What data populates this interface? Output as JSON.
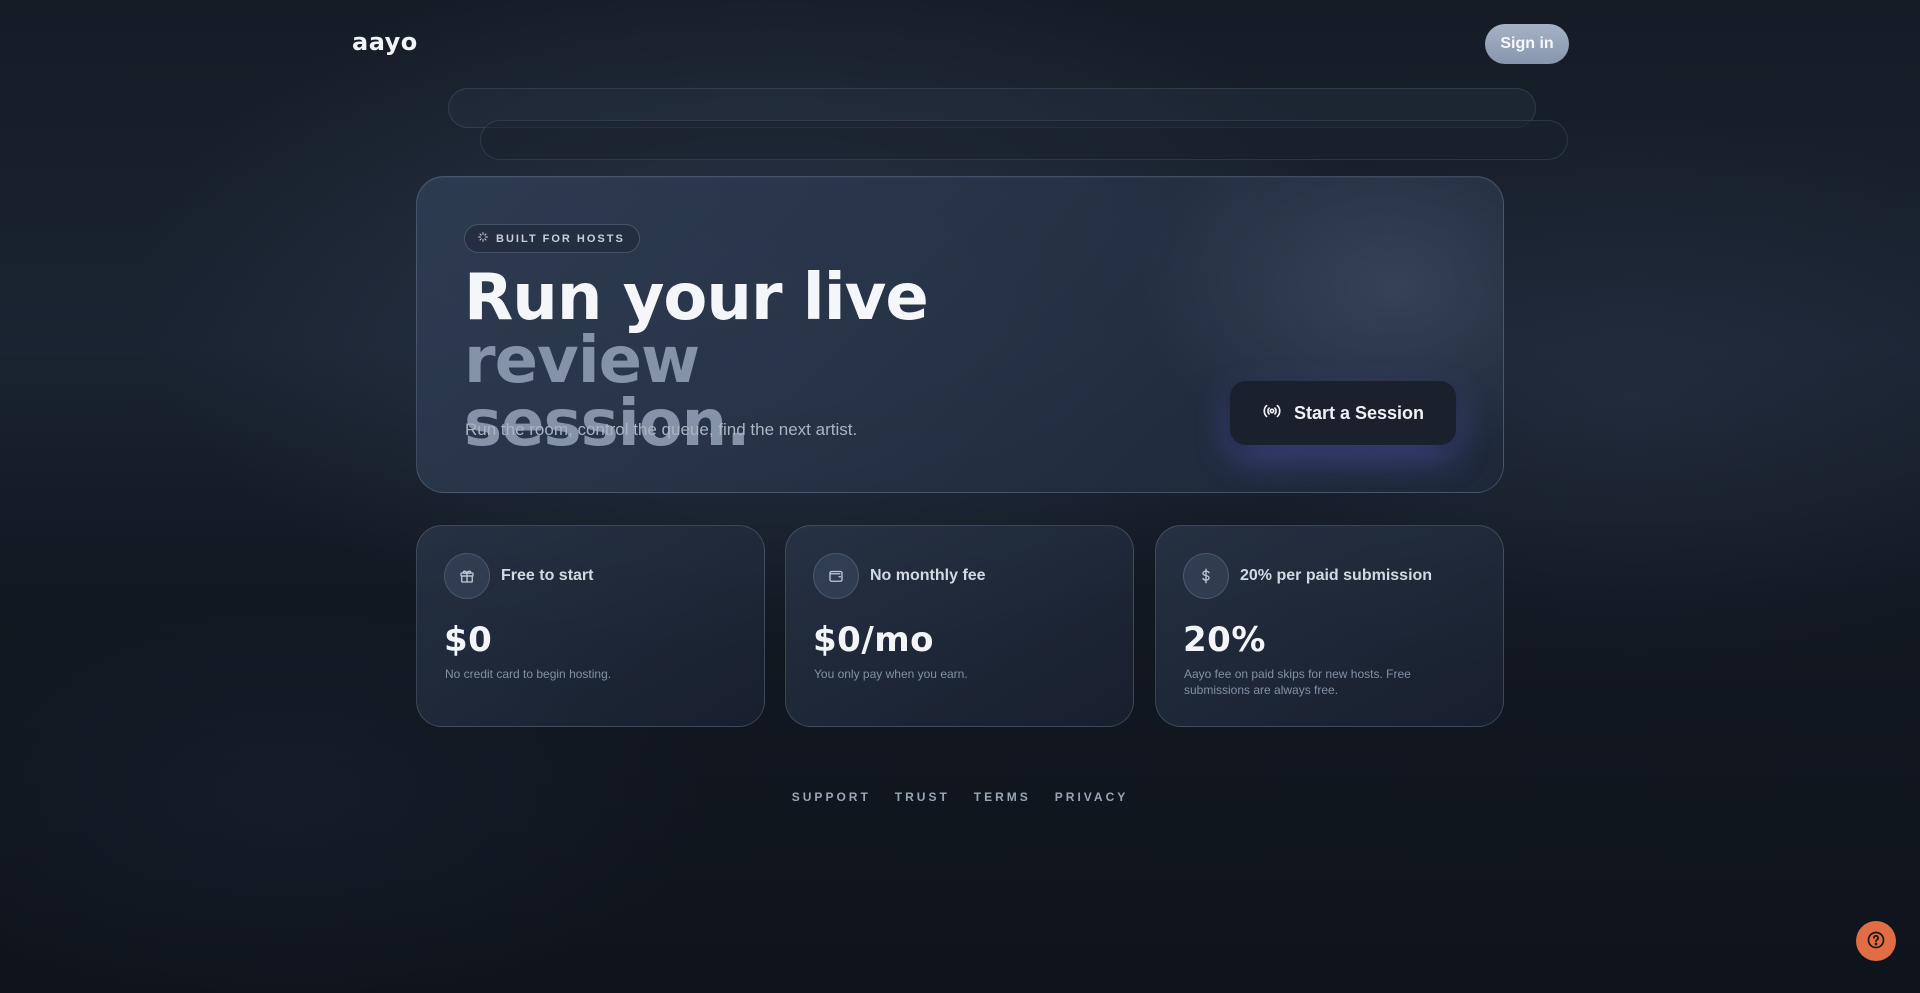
{
  "header": {
    "logo": "aayo",
    "signin_label": "Sign in"
  },
  "hero": {
    "badge": "BUILT FOR HOSTS",
    "headline_white": "Run your live ",
    "headline_muted_1": "review",
    "headline_muted_2": "session.",
    "subline": "Run the room, control the queue, find the next artist.",
    "cta_label": "Start a Session",
    "cta_icon": "broadcast-icon",
    "badge_icon": "sparkle-icon"
  },
  "cards": [
    {
      "icon": "gift-icon",
      "label": "Free to start",
      "value": "$0",
      "description": "No credit card to begin hosting."
    },
    {
      "icon": "wallet-icon",
      "label": "No monthly fee",
      "value": "$0/mo",
      "description": "You only pay when you earn."
    },
    {
      "icon": "dollar-icon",
      "label": "20% per paid submission",
      "value": "20%",
      "description": "Aayo fee on paid skips for new hosts. Free submissions are always free."
    }
  ],
  "footer": {
    "links": [
      "SUPPORT",
      "TRUST",
      "TERMS",
      "PRIVACY"
    ]
  },
  "help": {
    "icon": "help-icon"
  },
  "colors": {
    "accent_help": "#e06d43",
    "signin_bg": "#9aa7bb",
    "cta_glow": "#5a64d2",
    "headline_muted": "#8593a8"
  }
}
